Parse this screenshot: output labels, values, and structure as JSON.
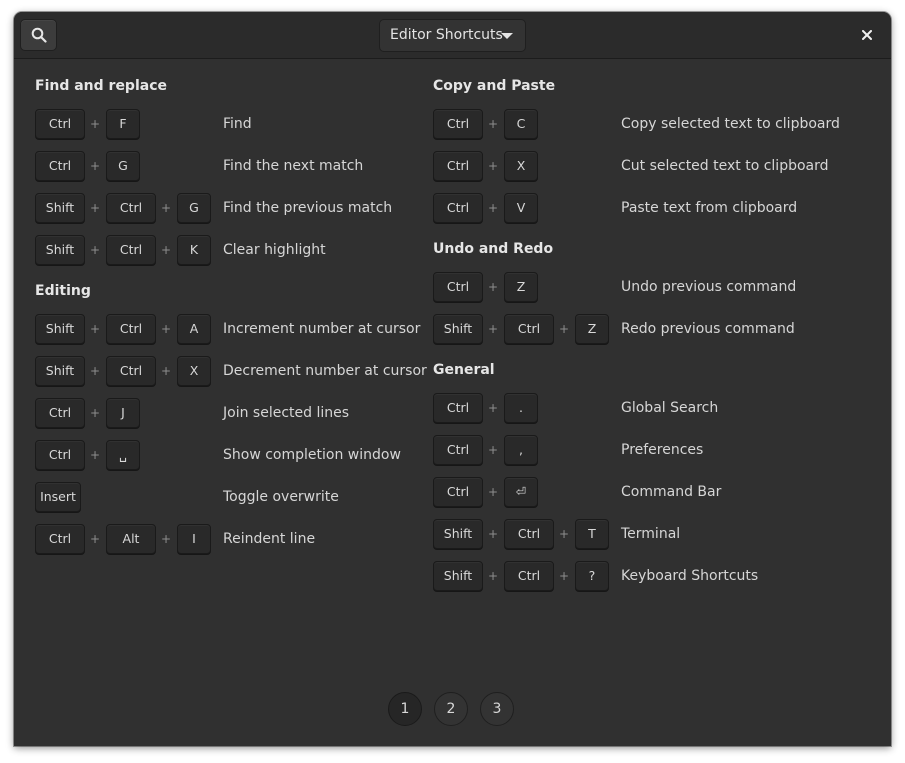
{
  "header": {
    "title": "Editor Shortcuts",
    "search_icon": "search-icon",
    "close_icon": "close-icon"
  },
  "left_sections": [
    {
      "title": "Find and replace",
      "items": [
        {
          "keys": [
            "Ctrl",
            "F"
          ],
          "desc": "Find"
        },
        {
          "keys": [
            "Ctrl",
            "G"
          ],
          "desc": "Find the next match"
        },
        {
          "keys": [
            "Shift",
            "Ctrl",
            "G"
          ],
          "desc": "Find the previous match"
        },
        {
          "keys": [
            "Shift",
            "Ctrl",
            "K"
          ],
          "desc": "Clear highlight"
        }
      ]
    },
    {
      "title": "Editing",
      "items": [
        {
          "keys": [
            "Shift",
            "Ctrl",
            "A"
          ],
          "desc": "Increment number at cursor"
        },
        {
          "keys": [
            "Shift",
            "Ctrl",
            "X"
          ],
          "desc": "Decrement number at cursor"
        },
        {
          "keys": [
            "Ctrl",
            "J"
          ],
          "desc": "Join selected lines"
        },
        {
          "keys": [
            "Ctrl",
            "␣"
          ],
          "desc": "Show completion window"
        },
        {
          "keys": [
            "Insert"
          ],
          "desc": "Toggle overwrite"
        },
        {
          "keys": [
            "Ctrl",
            "Alt",
            "I"
          ],
          "desc": "Reindent line"
        }
      ]
    }
  ],
  "right_sections": [
    {
      "title": "Copy and Paste",
      "items": [
        {
          "keys": [
            "Ctrl",
            "C"
          ],
          "desc": "Copy selected text to clipboard"
        },
        {
          "keys": [
            "Ctrl",
            "X"
          ],
          "desc": "Cut selected text to clipboard"
        },
        {
          "keys": [
            "Ctrl",
            "V"
          ],
          "desc": "Paste text from clipboard"
        }
      ]
    },
    {
      "title": "Undo and Redo",
      "items": [
        {
          "keys": [
            "Ctrl",
            "Z"
          ],
          "desc": "Undo previous command"
        },
        {
          "keys": [
            "Shift",
            "Ctrl",
            "Z"
          ],
          "desc": "Redo previous command"
        }
      ]
    },
    {
      "title": "General",
      "items": [
        {
          "keys": [
            "Ctrl",
            "."
          ],
          "desc": "Global Search"
        },
        {
          "keys": [
            "Ctrl",
            ","
          ],
          "desc": "Preferences"
        },
        {
          "keys": [
            "Ctrl",
            "⏎"
          ],
          "desc": "Command Bar"
        },
        {
          "keys": [
            "Shift",
            "Ctrl",
            "T"
          ],
          "desc": "Terminal"
        },
        {
          "keys": [
            "Shift",
            "Ctrl",
            "?"
          ],
          "desc": "Keyboard Shortcuts"
        }
      ]
    }
  ],
  "plus_symbol": "+",
  "pages": [
    "1",
    "2",
    "3"
  ],
  "active_page": "1"
}
